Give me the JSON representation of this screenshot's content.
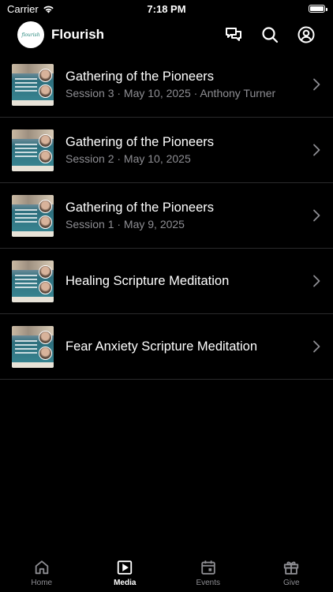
{
  "status_bar": {
    "carrier": "Carrier",
    "time": "7:18 PM"
  },
  "header": {
    "logo_text": "flourish",
    "title": "Flourish"
  },
  "media_items": [
    {
      "title": "Gathering of the Pioneers",
      "subtitle": "Session 3 · May 10, 2025 · Anthony Turner"
    },
    {
      "title": "Gathering of the Pioneers",
      "subtitle": "Session 2 · May 10, 2025"
    },
    {
      "title": "Gathering of the Pioneers",
      "subtitle": "Session 1 · May 9, 2025"
    },
    {
      "title": "Healing Scripture Meditation",
      "subtitle": ""
    },
    {
      "title": "Fear Anxiety Scripture Meditation",
      "subtitle": ""
    }
  ],
  "tabs": [
    {
      "label": "Home",
      "icon": "home-icon",
      "active": false
    },
    {
      "label": "Media",
      "icon": "play-icon",
      "active": true
    },
    {
      "label": "Events",
      "icon": "calendar-icon",
      "active": false
    },
    {
      "label": "Give",
      "icon": "gift-icon",
      "active": false
    }
  ],
  "colors": {
    "background": "#000000",
    "text_primary": "#ffffff",
    "text_secondary": "#8e8e93",
    "divider": "#2a2a2c"
  }
}
